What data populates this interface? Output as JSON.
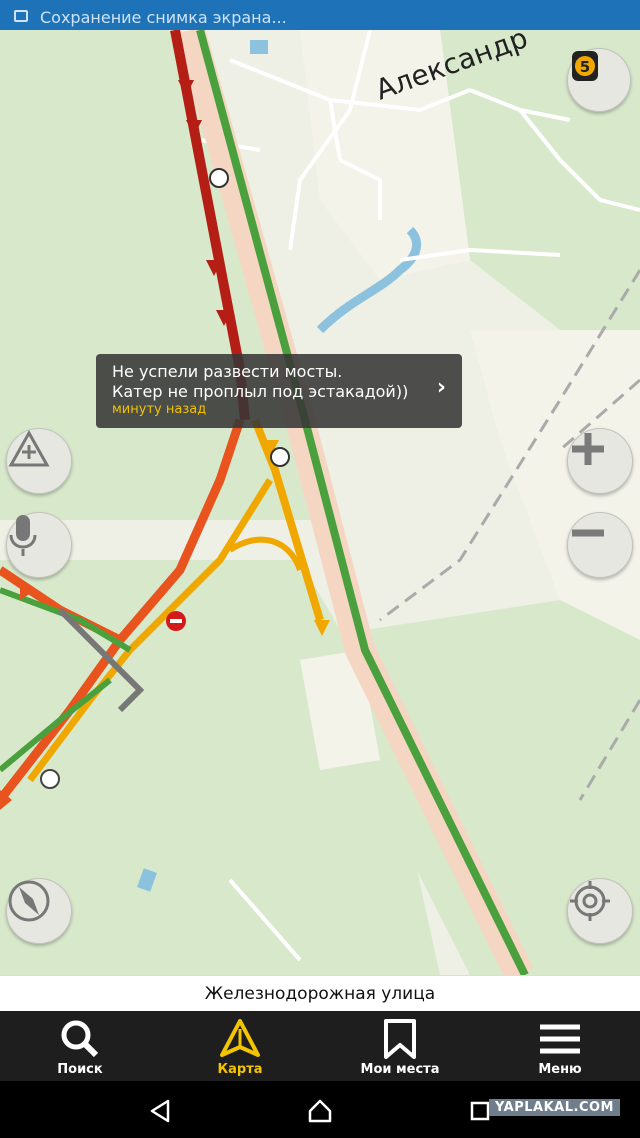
{
  "statusbar": {
    "title": "Сохранение снимка экрана..."
  },
  "map": {
    "label_town": "Александр",
    "traffic_score": "5",
    "event_tooltip": {
      "line1": "Не успели развести мосты.",
      "line2": "Катер не проплыл под эстакадой))",
      "time": "минуту назад"
    },
    "colors": {
      "jam_red": "#b41e14",
      "heavy_orange": "#e8531e",
      "slow_yellow": "#f0a800",
      "free_green": "#4aa03c",
      "water": "#7ab6d6",
      "forest": "#d7e8c9"
    }
  },
  "street_name": "Железнодорожная улица",
  "tabs": [
    {
      "label": "Поиск",
      "icon": "search-icon"
    },
    {
      "label": "Карта",
      "icon": "map-arrow-icon"
    },
    {
      "label": "Мои места",
      "icon": "bookmark-icon"
    },
    {
      "label": "Меню",
      "icon": "menu-icon"
    }
  ],
  "watermark": "YAPLAKAL.COM"
}
